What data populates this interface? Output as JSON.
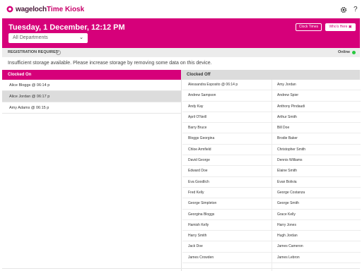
{
  "app": {
    "brand": "wageloch",
    "title": "Time Kiosk",
    "help": "?"
  },
  "header": {
    "datetime": "Tuesday, 1 December, 12:12 PM",
    "department_select": "All Departments",
    "clock_times_label": "Clock Times",
    "whos_here_label": "Who's Here"
  },
  "status": {
    "registration": "REGISTRATION REQUIRED",
    "online": "Online",
    "warning": "Insufficient storage available. Please increase storage by removing some data on this device."
  },
  "clocked_on": {
    "title": "Clocked On",
    "items": [
      "Alice Bloggs @ 06:14 p",
      "Alice Jordan @ 06:17 p",
      "Amy Adams @ 06:15 p"
    ]
  },
  "clocked_off": {
    "title": "Clocked Off",
    "col1": [
      "Alessandra Esposito @ 06:14 p",
      "Andrew Sampson",
      "Andy Kay",
      "April O'Neill",
      "Barry Bruce",
      "Bloggs Georgina",
      "Chloe Armfield",
      "David George",
      "Edward Doe",
      "Eva Goodlich",
      "Fred Kelly",
      "George Simpleton",
      "Georgina Bloggs",
      "Hamish Kelly",
      "Harry Smith",
      "Jack Doe",
      "James Crowden"
    ],
    "col2": [
      "Amy Jordan",
      "Andrew Spier",
      "Anthony Pindaudi",
      "Arthur Smith",
      "Bill Doe",
      "Brodie Baker",
      "Christopher Smith",
      "Dennis Williams",
      "Elaine Smith",
      "Evan Bolivia",
      "George Costanza",
      "George Smith",
      "Grace Kelly",
      "Harry Jones",
      "Hugh Jordan",
      "James Cameron",
      "James Lebron"
    ]
  },
  "colors": {
    "accent": "#d6007a",
    "online": "#27c93f"
  }
}
